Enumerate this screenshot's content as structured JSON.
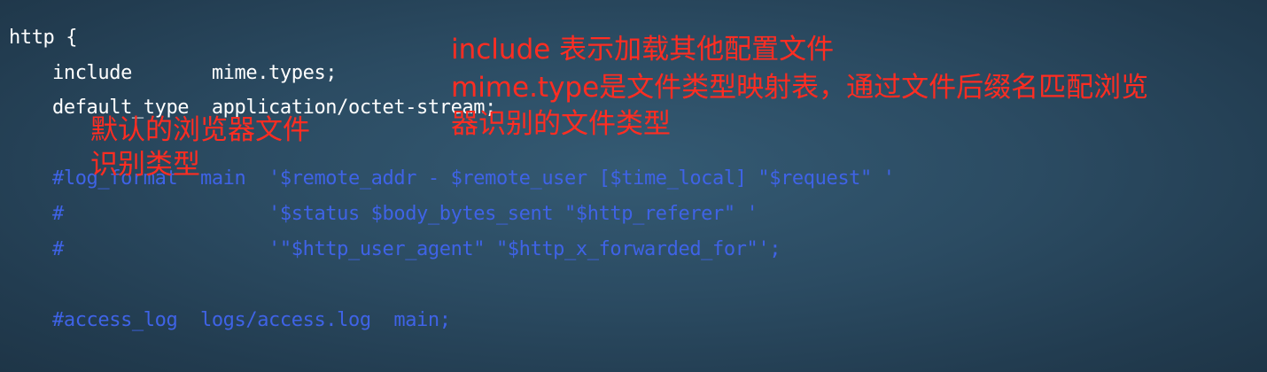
{
  "code": {
    "line_http": "http {",
    "line_include": "include       mime.types;",
    "line_default_type": "default_type  application/octet-stream;",
    "line_log_format_1": "#log_format  main  '$remote_addr - $remote_user [$time_local] \"$request\" '",
    "line_log_format_2": "#                  '$status $body_bytes_sent \"$http_referer\" '",
    "line_log_format_3": "#                  '\"$http_user_agent\" \"$http_x_forwarded_for\"';",
    "line_access_log": "#access_log  logs/access.log  main;"
  },
  "annotations": {
    "include_note_line1": "include 表示加载其他配置文件",
    "include_note_line2": "mime.type是文件类型映射表，通过文件后缀名匹配浏览",
    "include_note_line3": "器识别的文件类型",
    "default_note_line1": "默认的浏览器文件",
    "default_note_line2": "识别类型"
  },
  "colors": {
    "code_text": "#ffffff",
    "comment_text": "#3f63e6",
    "annotation_text": "#ff2d22",
    "background": "#2b4b62"
  }
}
